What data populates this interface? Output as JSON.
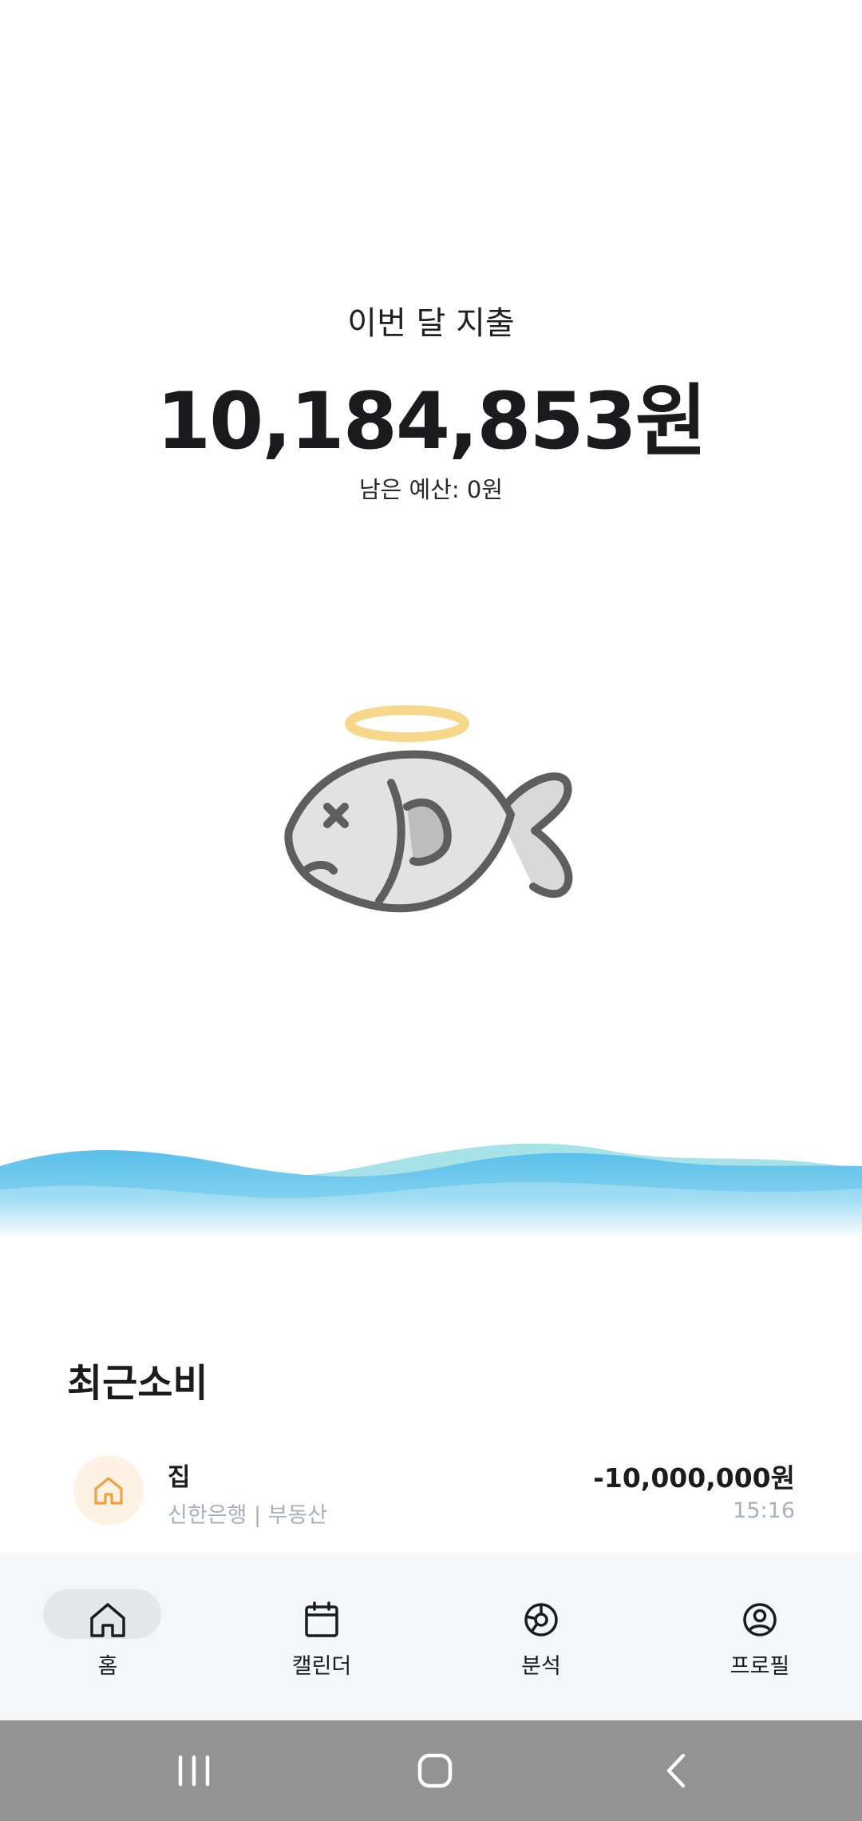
{
  "summary": {
    "label": "이번 달 지출",
    "total": "10,184,853원",
    "budget_remaining": "남은 예산: 0원"
  },
  "illustration": {
    "icon": "dead-fish-with-halo-icon"
  },
  "recent": {
    "title": "최근소비",
    "transactions": [
      {
        "name": "집",
        "detail": "신한은행 | 부동산",
        "amount": "-10,000,000원",
        "time": "15:16",
        "icon": "house-icon"
      }
    ]
  },
  "nav": {
    "items": [
      {
        "label": "홈",
        "icon": "home-icon",
        "active": true
      },
      {
        "label": "캘린더",
        "icon": "calendar-icon",
        "active": false
      },
      {
        "label": "분석",
        "icon": "chart-pie-icon",
        "active": false
      },
      {
        "label": "프로필",
        "icon": "profile-icon",
        "active": false
      }
    ]
  },
  "colors": {
    "accent_orange": "#f2a13b",
    "wave_blue": "#56bde9",
    "wave_teal": "#9cdfe4",
    "halo": "#f7d88a",
    "fish_outline": "#5e5e5e"
  }
}
